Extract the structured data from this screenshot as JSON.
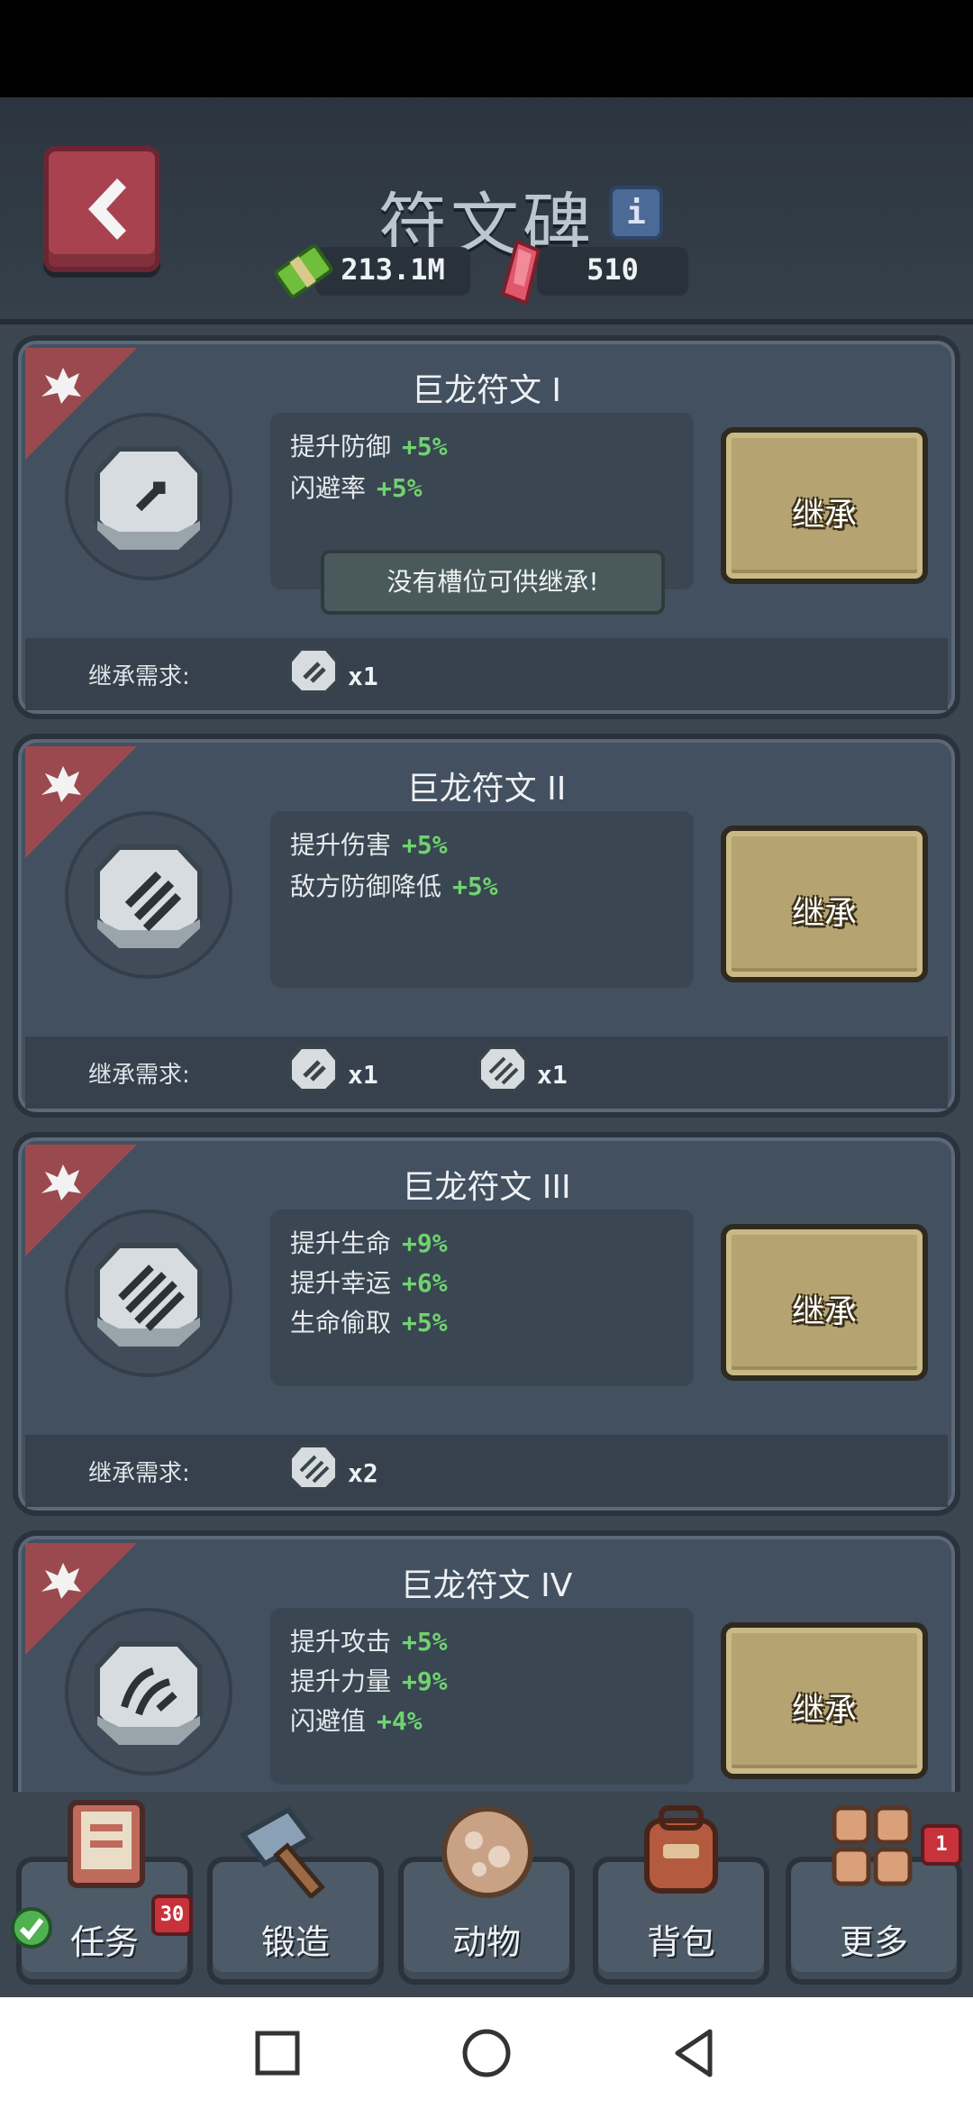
{
  "header": {
    "title": "符文碑",
    "money": "213.1M",
    "gems": "510"
  },
  "runes": [
    {
      "title": "巨龙符文 I",
      "stats": [
        {
          "label": "提升防御",
          "value": "+5%"
        },
        {
          "label": "闪避率",
          "value": "+5%"
        }
      ],
      "notice": "没有槽位可供继承!",
      "button": "继承",
      "req_label": "继承需求:",
      "requirements": [
        {
          "qty": "x1"
        }
      ]
    },
    {
      "title": "巨龙符文 II",
      "stats": [
        {
          "label": "提升伤害",
          "value": "+5%"
        },
        {
          "label": "敌方防御降低",
          "value": "+5%"
        }
      ],
      "button": "继承",
      "req_label": "继承需求:",
      "requirements": [
        {
          "qty": "x1"
        },
        {
          "qty": "x1"
        }
      ]
    },
    {
      "title": "巨龙符文 III",
      "stats": [
        {
          "label": "提升生命",
          "value": "+9%"
        },
        {
          "label": "提升幸运",
          "value": "+6%"
        },
        {
          "label": "生命偷取",
          "value": "+5%"
        }
      ],
      "button": "继承",
      "req_label": "继承需求:",
      "requirements": [
        {
          "qty": "x2"
        }
      ]
    },
    {
      "title": "巨龙符文 IV",
      "stats": [
        {
          "label": "提升攻击",
          "value": "+5%"
        },
        {
          "label": "提升力量",
          "value": "+9%"
        },
        {
          "label": "闪避值",
          "value": "+4%"
        }
      ],
      "button": "继承"
    }
  ],
  "nav": [
    {
      "label": "任务",
      "icon": "task-book-icon",
      "badge": "30"
    },
    {
      "label": "锻造",
      "icon": "hammer-icon"
    },
    {
      "label": "动物",
      "icon": "egg-icon"
    },
    {
      "label": "背包",
      "icon": "backpack-icon"
    },
    {
      "label": "更多",
      "icon": "grid-icon",
      "badge": "1"
    }
  ],
  "colors": {
    "accent_green": "#6fd36f",
    "back_button": "#a8424f",
    "inherit_button": "#b5a472",
    "badge_red": "#c8323b"
  }
}
